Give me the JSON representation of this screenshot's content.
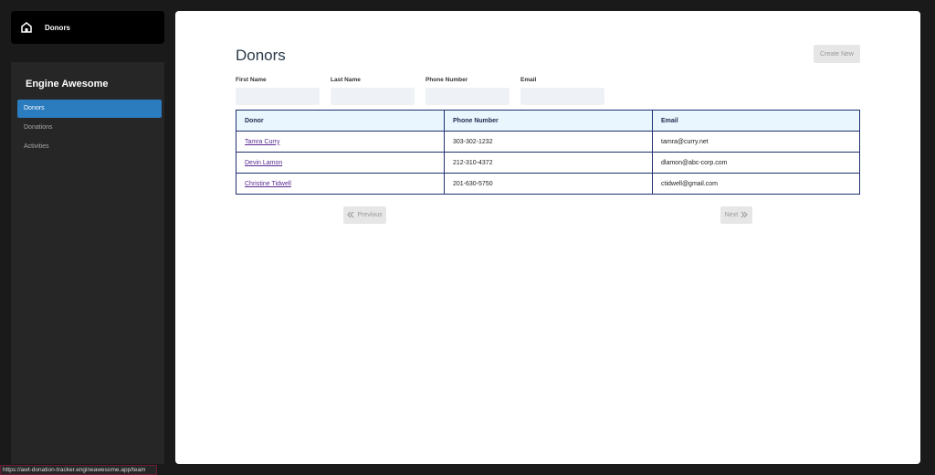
{
  "sidebar": {
    "header_label": "Donors",
    "app_name": "Engine Awesome",
    "items": [
      {
        "label": "Donors",
        "active": true
      },
      {
        "label": "Donations",
        "active": false
      },
      {
        "label": "Activities",
        "active": false
      }
    ]
  },
  "main": {
    "title": "Donors",
    "create_label": "Create New",
    "filters": {
      "first_name": "First Name",
      "last_name": "Last Name",
      "phone_number": "Phone Number",
      "email": "Email"
    },
    "table": {
      "headers": [
        "Donor",
        "Phone Number",
        "Email"
      ],
      "rows": [
        {
          "name": "Tamra Curry",
          "phone": "303-302-1232",
          "email": "tamra@curry.net"
        },
        {
          "name": "Devin Lamon",
          "phone": "212-310-4372",
          "email": "dlamon@abc-corp.com"
        },
        {
          "name": "Christine Tidwell",
          "phone": "201-630-5750",
          "email": "ctidwell@gmail.com"
        }
      ]
    },
    "pager": {
      "previous": "Previous",
      "next": "Next"
    }
  },
  "status_url": "https://awt-donation-tracker.engineawesome.app/team"
}
